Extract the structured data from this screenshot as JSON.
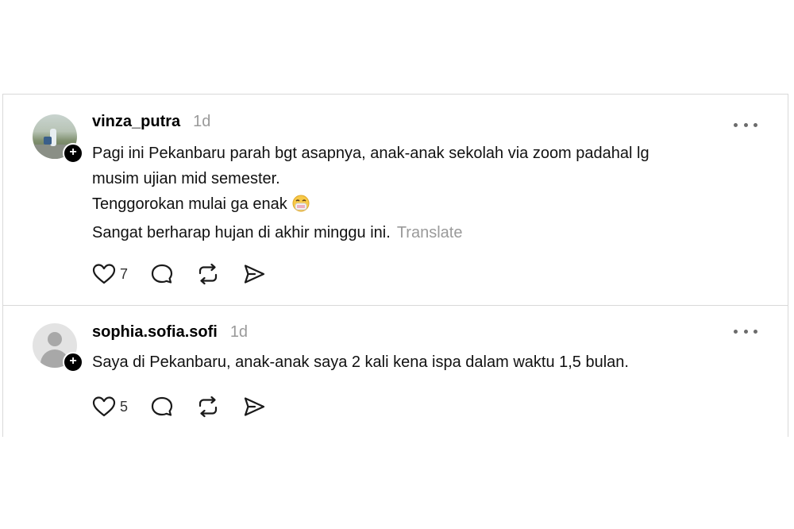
{
  "posts": [
    {
      "username": "vinza_putra",
      "time": "1d",
      "lines": [
        "Pagi ini Pekanbaru parah bgt asapnya, anak-anak sekolah via zoom padahal lg",
        "musim ujian mid semester.",
        "Tenggorokan mulai ga enak",
        "Sangat berharap hujan di akhir minggu ini."
      ],
      "emoji": "😷",
      "translate_label": "Translate",
      "likes": "7"
    },
    {
      "username": "sophia.sofia.sofi",
      "time": "1d",
      "lines": [
        "Saya di Pekanbaru, anak-anak saya 2 kali kena ispa dalam waktu 1,5 bulan."
      ],
      "likes": "5"
    }
  ],
  "icons": {
    "like": "heart-icon",
    "reply": "comment-icon",
    "repost": "repost-icon",
    "share": "send-icon",
    "more": "more-icon",
    "follow": "plus-icon"
  },
  "follow_badge": "+"
}
